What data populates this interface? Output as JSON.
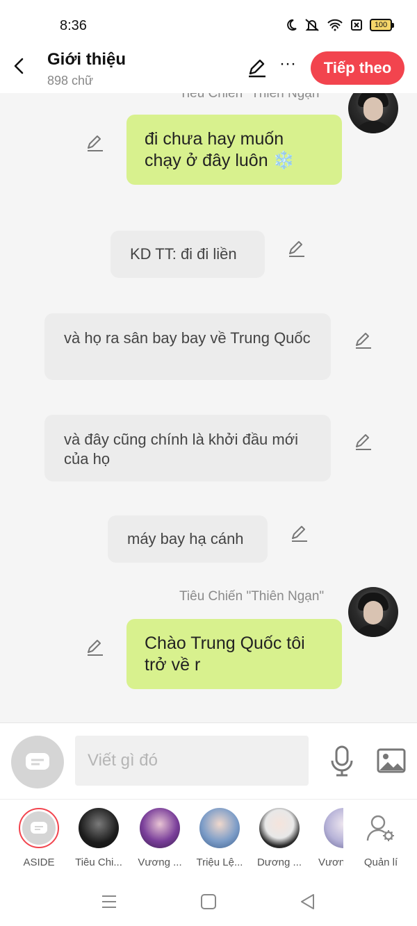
{
  "status_bar": {
    "time": "8:36",
    "battery": "100"
  },
  "header": {
    "title": "Giới thiệu",
    "subtitle": "898 chữ",
    "next_label": "Tiếp theo",
    "more_label": "···"
  },
  "messages": {
    "top_name": "Tiêu Chiến  \"Thiên Ngạn\"",
    "m1": "đi chưa hay muốn chạy ở đây luôn ❄️",
    "m2": "KD TT: đi đi liền",
    "m3": "và họ ra sân bay bay về Trung Quốc",
    "m4": "và đây cũng chính là khởi đầu mới của họ",
    "m5": "máy bay hạ cánh",
    "m6_name": "Tiêu Chiến  \"Thiên Ngạn\"",
    "m6": "Chào Trung Quốc tôi trở về r"
  },
  "composer": {
    "placeholder": "Viết gì đó"
  },
  "characters": [
    {
      "name": "ASIDE"
    },
    {
      "name": "Tiêu Chi..."
    },
    {
      "name": "Vương ..."
    },
    {
      "name": "Triệu Lệ..."
    },
    {
      "name": "Dương ..."
    },
    {
      "name": "Vương"
    },
    {
      "name": "Quản lí"
    }
  ],
  "colors": {
    "accent": "#f2444e",
    "user_bubble": "#d8f18e",
    "narration_bubble": "#ececec"
  }
}
